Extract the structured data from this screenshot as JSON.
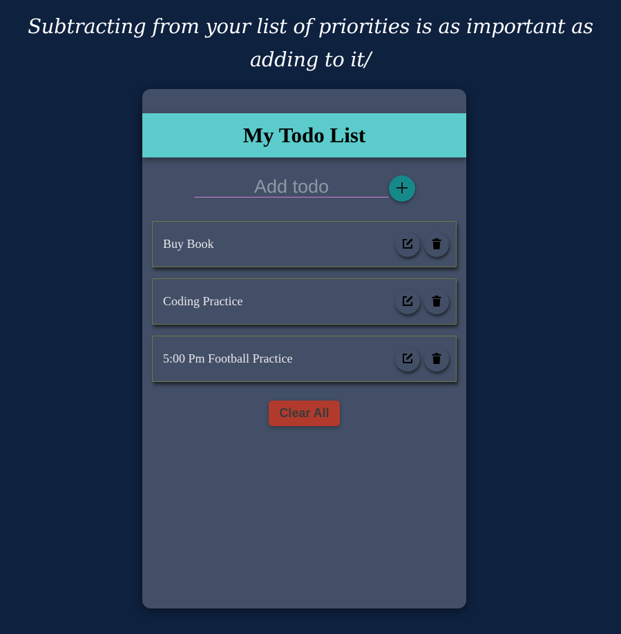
{
  "quote": {
    "text": "Subtracting from your list of priorities is as important as adding to it/"
  },
  "app": {
    "title": "My Todo List"
  },
  "add_form": {
    "placeholder": "Add todo",
    "value": "",
    "add_icon": "plus-icon"
  },
  "todos": [
    {
      "text": "Buy Book",
      "edit_icon": "edit-icon",
      "delete_icon": "trash-icon"
    },
    {
      "text": "Coding Practice",
      "edit_icon": "edit-icon",
      "delete_icon": "trash-icon"
    },
    {
      "text": "5:00 Pm Football Practice",
      "edit_icon": "edit-icon",
      "delete_icon": "trash-icon"
    }
  ],
  "actions": {
    "clear_all_label": "Clear All"
  },
  "colors": {
    "page_background": "#0e213f",
    "card_background": "#434f66",
    "header_accent": "#5ccbcb",
    "add_button": "#168a8a",
    "clear_button": "#b13a2c",
    "input_underline": "#d67ad6"
  }
}
